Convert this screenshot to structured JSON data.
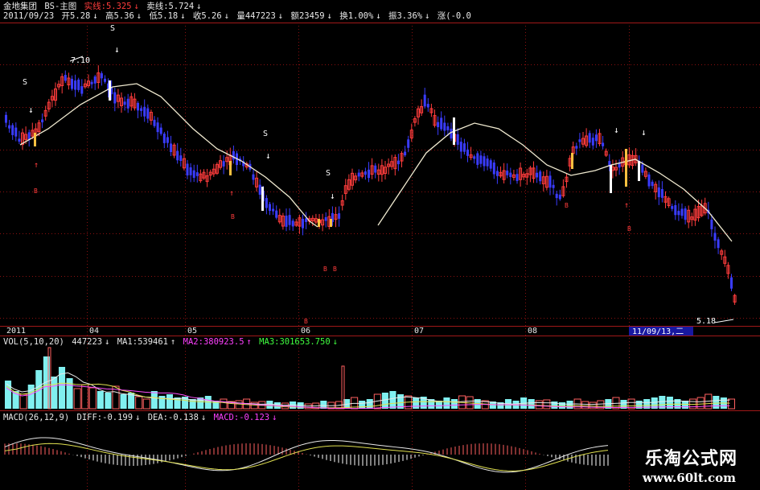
{
  "window": {
    "stock_name": "金地集团",
    "panel_title": "BS-主图",
    "solid_label": "实线:5.325",
    "sell_label": "卖线:5.724"
  },
  "quote": {
    "date": "2011/09/23",
    "open": "开5.28",
    "high": "高5.36",
    "low": "低5.18",
    "close": "收5.26",
    "volume": "量447223",
    "amount": "额23459",
    "turnover": "换1.00%",
    "amplitude": "振3.36%",
    "change": "涨(-0.0"
  },
  "main_chart": {
    "high_label": "7.10",
    "low_label": "5.18",
    "signal_buy_letter": "B",
    "signal_sell_letter": "S",
    "colors": {
      "up": "#ff3c3c",
      "down": "#3a3cff",
      "ma": "#f0ead0",
      "grid": "#8a1010",
      "signal_bar": "#ffffff",
      "signal_bar_alt": "#ffc040"
    }
  },
  "time_axis": {
    "labels": [
      "2011",
      "04",
      "05",
      "06",
      "07",
      "08"
    ],
    "cursor_label": "11/09/13,二"
  },
  "volume_panel": {
    "title": "VOL(5,10,20)",
    "value": "447223",
    "ma1": "MA1:539461",
    "ma2": "MA2:380923.5",
    "ma3": "MA3:301653.750",
    "colors": {
      "up": "#ff6060",
      "down": "#80f0f0"
    }
  },
  "macd_panel": {
    "title": "MACD(26,12,9)",
    "diff": "DIFF:-0.199",
    "dea": "DEA:-0.138",
    "macd": "MACD:-0.123",
    "colors": {
      "pos": "#ff6060",
      "neg": "#ffffff"
    }
  },
  "watermark": {
    "text": "乐淘公式网",
    "url": "www.60lt.com"
  }
}
